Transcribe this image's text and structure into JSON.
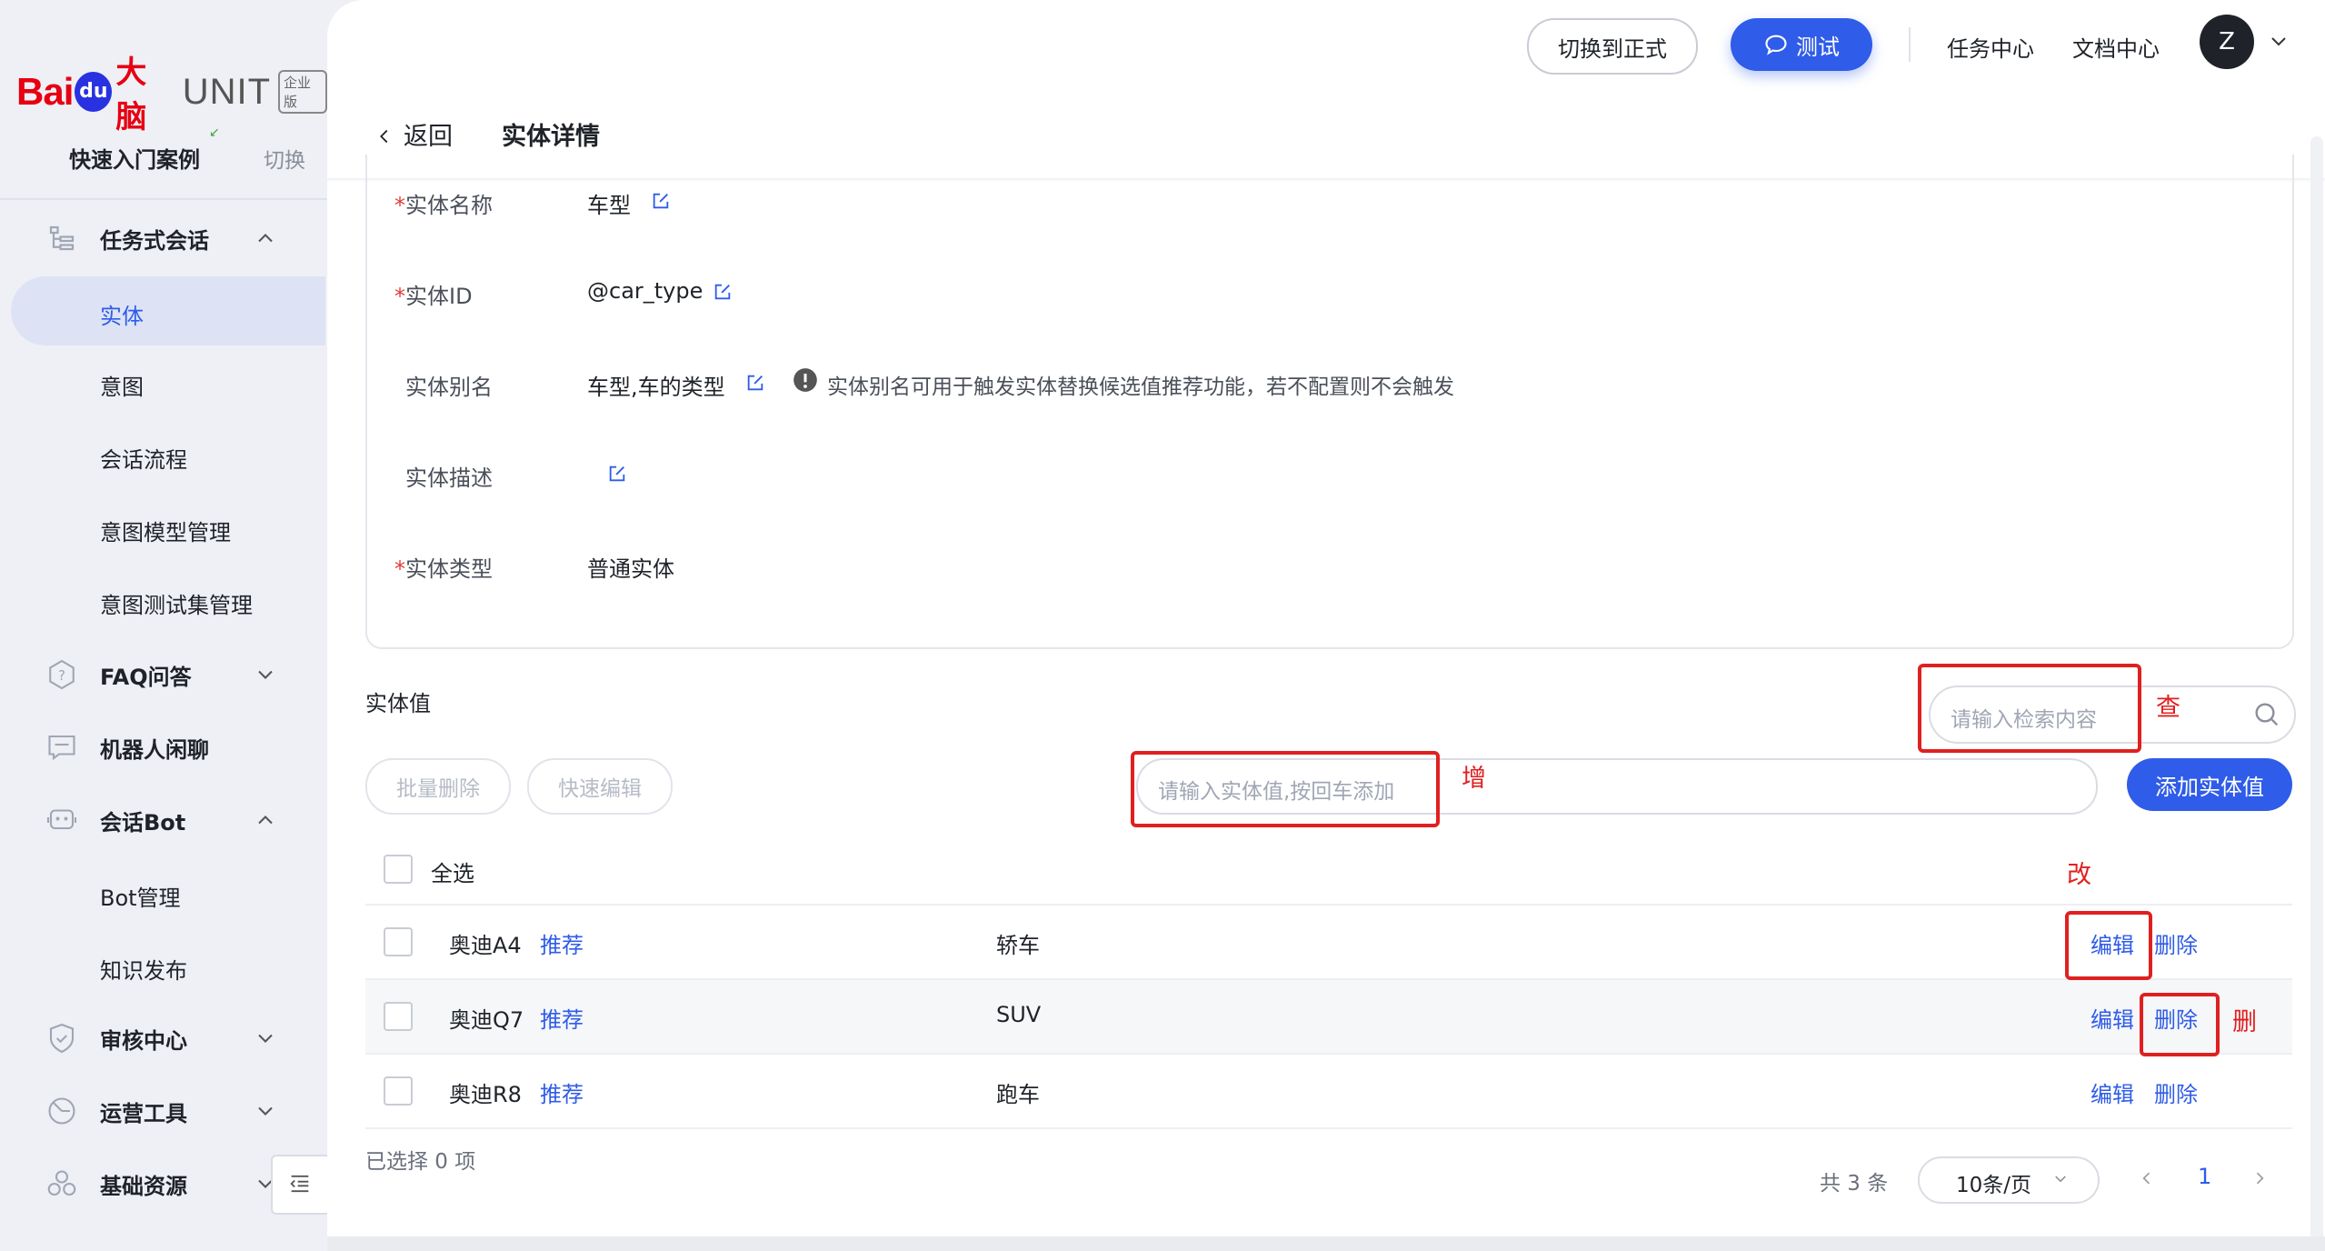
{
  "brand": {
    "bai": "Bai",
    "du": "du",
    "danao": "大脑",
    "unit": "UNIT",
    "edition": "企业版"
  },
  "project": {
    "name": "快速入门案例",
    "switch": "切换"
  },
  "sidebar": {
    "task_dialog": "任务式会话",
    "entity": "实体",
    "intent": "意图",
    "dialog_flow": "会话流程",
    "intent_model": "意图模型管理",
    "intent_testset": "意图测试集管理",
    "faq": "FAQ问答",
    "chitchat": "机器人闲聊",
    "dialog_bot": "会话Bot",
    "bot_manage": "Bot管理",
    "knowledge_publish": "知识发布",
    "review_center": "审核中心",
    "ops_tools": "运营工具",
    "base_resources": "基础资源"
  },
  "topbar": {
    "switch_formal": "切换到正式",
    "test": "测试",
    "task_center": "任务中心",
    "doc_center": "文档中心",
    "avatar_letter": "Z"
  },
  "header": {
    "back": "返回",
    "title": "实体详情"
  },
  "entity": {
    "name_label": "实体名称",
    "name_value": "车型",
    "id_label": "实体ID",
    "id_value": "@car_type",
    "alias_label": "实体别名",
    "alias_value": "车型,车的类型",
    "alias_hint": "实体别名可用于触发实体替换候选值推荐功能，若不配置则不会触发",
    "desc_label": "实体描述",
    "desc_value": "",
    "type_label": "实体类型",
    "type_value": "普通实体"
  },
  "values_section": {
    "title": "实体值",
    "search_placeholder": "请输入检索内容",
    "batch_delete": "批量删除",
    "quick_edit": "快速编辑",
    "add_placeholder": "请输入实体值,按回车添加",
    "add_button": "添加实体值",
    "select_all": "全选"
  },
  "table": {
    "rows": [
      {
        "name": "奥迪A4",
        "recommend": "推荐",
        "synonym": "轿车",
        "edit": "编辑",
        "delete": "删除"
      },
      {
        "name": "奥迪Q7",
        "recommend": "推荐",
        "synonym": "SUV",
        "edit": "编辑",
        "delete": "删除"
      },
      {
        "name": "奥迪R8",
        "recommend": "推荐",
        "synonym": "跑车",
        "edit": "编辑",
        "delete": "删除"
      }
    ]
  },
  "annotations": {
    "search": "查",
    "add": "增",
    "edit": "改",
    "delete": "删",
    "color": "#e02020"
  },
  "footer": {
    "selected": "已选择 0 项",
    "total": "共 3 条",
    "page_size": "10条/页",
    "page": "1"
  },
  "colors": {
    "primary": "#2f5ce8",
    "required": "#e23c39",
    "brand_red": "#e60012"
  }
}
